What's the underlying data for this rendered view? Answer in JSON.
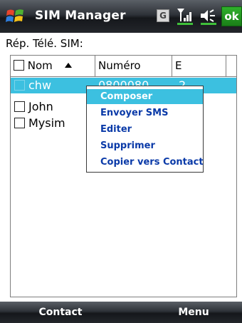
{
  "titlebar": {
    "title": "SIM Manager",
    "start_icon": "windows-flag-icon",
    "status_g": "G",
    "signal_icon": "signal-strength-icon",
    "volume_icon": "speaker-volume-icon",
    "ok_label": "ok"
  },
  "main": {
    "section_label": "Rép. Télé. SIM:",
    "columns": {
      "name": "Nom",
      "number": "Numéro",
      "e": "E",
      "sort_icon": "sort-ascending-icon"
    },
    "rows": [
      {
        "name": "chw",
        "number": "0800080",
        "e": "2",
        "selected": true
      },
      {
        "name": "John",
        "number": "",
        "e": "",
        "selected": false
      },
      {
        "name": "Mysim",
        "number": "",
        "e": "",
        "selected": false
      }
    ]
  },
  "context_menu": {
    "items": [
      {
        "label": "Composer",
        "active": true
      },
      {
        "label": "Envoyer SMS",
        "active": false
      },
      {
        "label": "Editer",
        "active": false
      },
      {
        "label": "Supprimer",
        "active": false
      },
      {
        "label": "Copier vers Contact",
        "active": false
      }
    ]
  },
  "softkeys": {
    "left": "Contact",
    "right": "Menu"
  },
  "colors": {
    "selection": "#3cc0e0",
    "menu_text": "#0a3aa8",
    "ok_green": "#2fb02b"
  }
}
